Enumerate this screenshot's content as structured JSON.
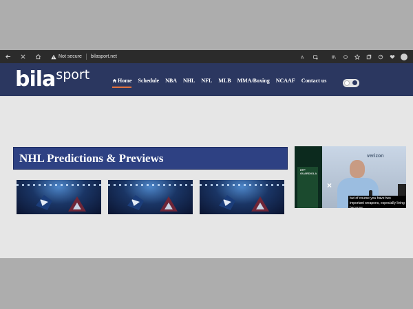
{
  "browser": {
    "security_label": "Not secure",
    "url": "bilasport.net",
    "icons": [
      "back-icon",
      "close-icon",
      "home-icon",
      "warning-icon",
      "read-aloud-icon",
      "extension-icon",
      "reading-view-icon",
      "refresh-icon",
      "favorite-icon",
      "collections-icon",
      "performance-icon",
      "wallet-icon",
      "profile-icon"
    ]
  },
  "site": {
    "logo": {
      "primary": "bila",
      "secondary": "sport"
    },
    "nav": [
      {
        "label": "Home",
        "active": true
      },
      {
        "label": "Schedule"
      },
      {
        "label": "NBA"
      },
      {
        "label": "NHL"
      },
      {
        "label": "NFL"
      },
      {
        "label": "MLB"
      },
      {
        "label": "MMA/Boxing"
      },
      {
        "label": "NCAAF"
      },
      {
        "label": "Contact us"
      }
    ],
    "theme_toggle": "theme-toggle"
  },
  "main": {
    "section_title": "NHL Predictions & Previews",
    "cards": [
      "card-1",
      "card-2",
      "card-3"
    ]
  },
  "video_ad": {
    "sponsor_top": "verizon",
    "sidebar_text": "EFP GUARDIOLA",
    "caption": "but of course you have two important weapons, especially living because"
  },
  "colors": {
    "header": "#2b3760",
    "section_title": "#2e4183",
    "nav_active_underline": "#e5713b",
    "page_bg": "#e6e6e6"
  }
}
